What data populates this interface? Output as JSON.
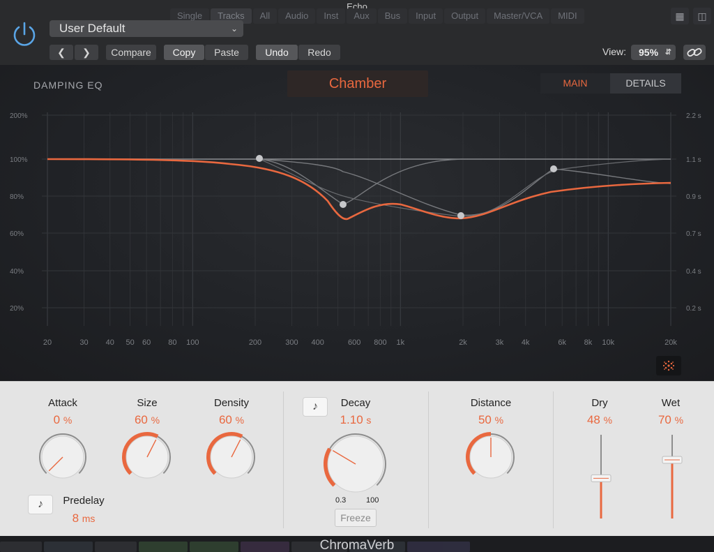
{
  "window": {
    "title": "Echo",
    "strip_tabs": [
      "Single",
      "Tracks",
      "All",
      "Audio",
      "Inst",
      "Aux",
      "Bus",
      "Input",
      "Output",
      "Master/VCA",
      "MIDI"
    ]
  },
  "header": {
    "preset": "User Default",
    "compare_label": "Compare",
    "copy_label": "Copy",
    "paste_label": "Paste",
    "undo_label": "Undo",
    "redo_label": "Redo",
    "view_label": "View:",
    "zoom": "95%"
  },
  "eq": {
    "title": "DAMPING EQ",
    "mode": "Chamber",
    "tabs": [
      "MAIN",
      "DETAILS"
    ],
    "left_axis": [
      "200%",
      "100%",
      "80%",
      "60%",
      "40%",
      "20%"
    ],
    "right_axis": [
      "2.2 s",
      "1.1 s",
      "0.9 s",
      "0.7 s",
      "0.4 s",
      "0.2 s"
    ],
    "freq_axis": [
      "20",
      "30",
      "40",
      "50",
      "60",
      "80",
      "100",
      "200",
      "300",
      "400",
      "600",
      "800",
      "1k",
      "2k",
      "3k",
      "4k",
      "6k",
      "8k",
      "10k",
      "20k"
    ],
    "accent": "#e9683f"
  },
  "controls": {
    "attack": {
      "name": "Attack",
      "value": "0",
      "unit": "%",
      "level": 0.0
    },
    "size": {
      "name": "Size",
      "value": "60",
      "unit": "%",
      "level": 0.6
    },
    "density": {
      "name": "Density",
      "value": "60",
      "unit": "%",
      "level": 0.6
    },
    "predelay": {
      "name": "Predelay",
      "value": "8",
      "unit": "ms"
    },
    "decay": {
      "name": "Decay",
      "value": "1.10",
      "unit": "s",
      "level": 0.28,
      "range_min": "0.3",
      "range_max": "100",
      "freeze_label": "Freeze"
    },
    "distance": {
      "name": "Distance",
      "value": "50",
      "unit": "%",
      "level": 0.5
    },
    "dry": {
      "name": "Dry",
      "value": "48",
      "unit": "%",
      "level": 0.48
    },
    "wet": {
      "name": "Wet",
      "value": "70",
      "unit": "%",
      "level": 0.7
    }
  },
  "footer": {
    "brand": "ChromaVerb"
  }
}
